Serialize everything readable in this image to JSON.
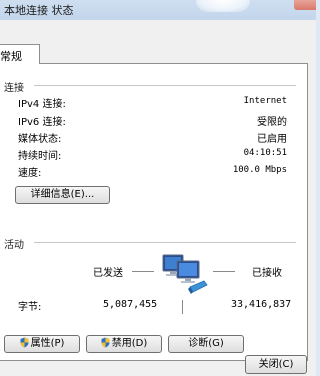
{
  "window": {
    "title": "本地连接 状态"
  },
  "tabs": [
    {
      "label": "常规"
    }
  ],
  "connection": {
    "header": "连接",
    "rows": [
      {
        "label": "IPv4 连接:",
        "value": "Internet"
      },
      {
        "label": "IPv6 连接:",
        "value": "受限的"
      },
      {
        "label": "媒体状态:",
        "value": "已启用"
      },
      {
        "label": "持续时间:",
        "value": "04:10:51"
      },
      {
        "label": "速度:",
        "value": "100.0 Mbps"
      }
    ],
    "details_button": "详细信息(E)..."
  },
  "activity": {
    "header": "活动",
    "sent_label": "已发送",
    "received_label": "已接收",
    "bytes_label": "字节:",
    "bytes_sent": "5,087,455",
    "bytes_received": "33,416,837"
  },
  "buttons": {
    "properties": "属性(P)",
    "disable": "禁用(D)",
    "diagnose": "诊断(G)",
    "close": "关闭(C)"
  },
  "icons": {
    "network": "network-computers-icon",
    "shield": "uac-shield-icon"
  }
}
